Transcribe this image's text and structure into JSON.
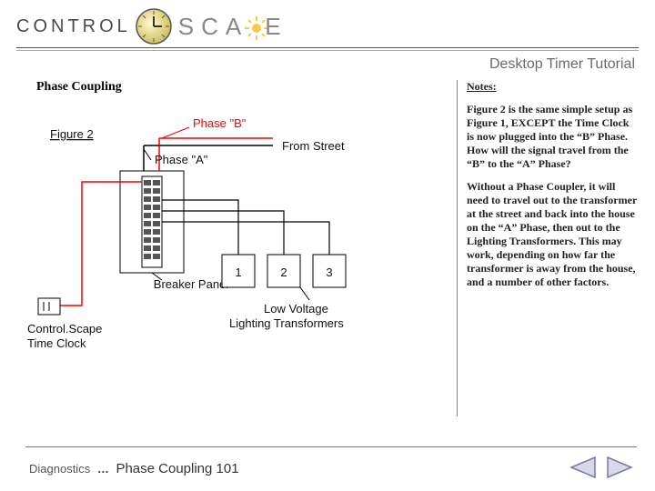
{
  "logo": {
    "left": "CONTROL",
    "right": "SCA",
    "right2": "E"
  },
  "header": {
    "subtitle": "Desktop Timer Tutorial"
  },
  "page": {
    "title": "Phase Coupling"
  },
  "diagram": {
    "figure_label": "Figure 2",
    "phase_a": "Phase \"A\"",
    "phase_b": "Phase \"B\"",
    "from_street": "From Street",
    "breaker_panel": "Breaker Panel",
    "time_clock": "Control.Scape\nTime Clock",
    "transformers": "Low Voltage\nLighting Transformers",
    "boxes": [
      "1",
      "2",
      "3"
    ]
  },
  "notes": {
    "heading": "Notes:",
    "p1": "Figure 2 is the same simple setup as Figure 1, EXCEPT the Time Clock is now plugged into the “B” Phase. How will the signal travel from the “B” to the “A” Phase?",
    "p2": "Without a Phase Coupler, it will need to travel out to the transformer at the street and back into the house on the “A” Phase, then out to the Lighting Transformers. This may work, depending on how far the transformer is away from the house, and a number of other factors."
  },
  "footer": {
    "crumb1": "Diagnostics",
    "sep": "…",
    "crumb2": "Phase Coupling 101"
  }
}
